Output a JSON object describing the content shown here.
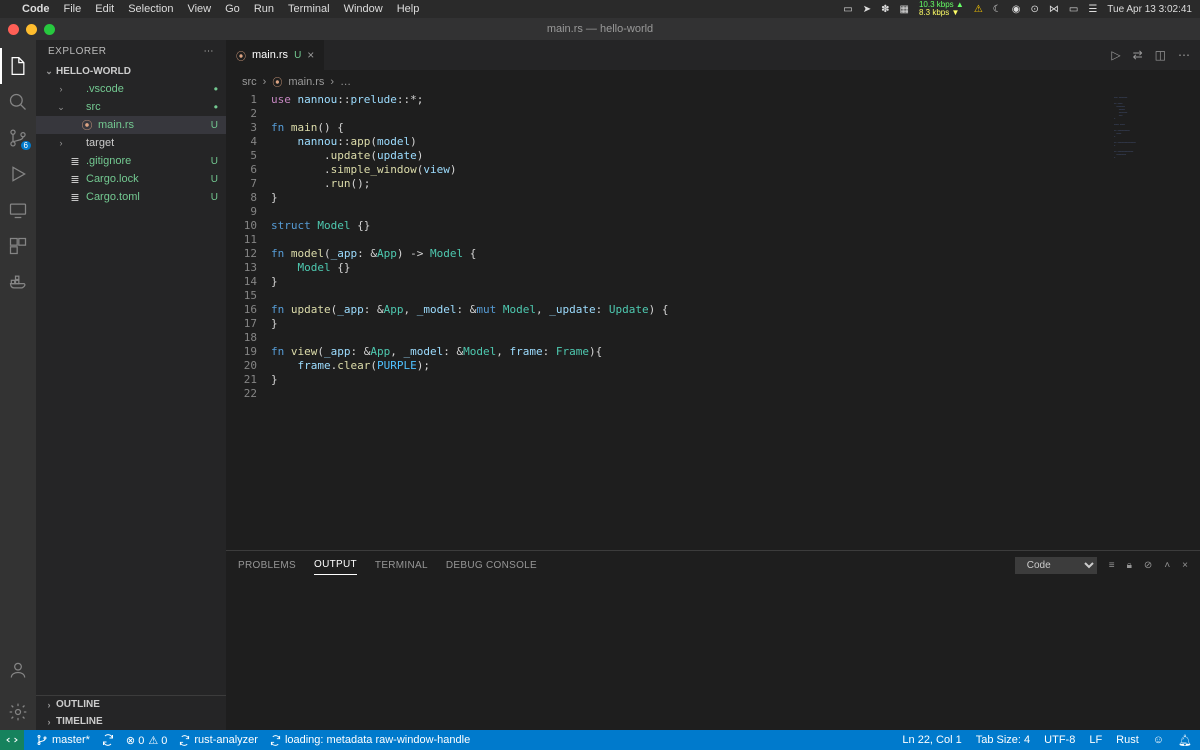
{
  "menubar": {
    "app": "Code",
    "items": [
      "File",
      "Edit",
      "Selection",
      "View",
      "Go",
      "Run",
      "Terminal",
      "Window",
      "Help"
    ],
    "datetime": "Tue Apr 13  3:02:41",
    "net_up": "10.3 kbps",
    "net_down": "8.3 kbps"
  },
  "window": {
    "title": "main.rs — hello-world"
  },
  "sidebar": {
    "title": "EXPLORER",
    "folder": "HELLO-WORLD",
    "items": [
      {
        "label": ".vscode",
        "kind": "folder-closed",
        "indent": 1,
        "status": "dot"
      },
      {
        "label": "src",
        "kind": "folder-open",
        "indent": 1,
        "status": "dot"
      },
      {
        "label": "main.rs",
        "kind": "rust",
        "indent": 2,
        "status": "U",
        "selected": true
      },
      {
        "label": "target",
        "kind": "folder-closed",
        "indent": 1,
        "status": ""
      },
      {
        "label": ".gitignore",
        "kind": "file",
        "indent": 1,
        "status": "U"
      },
      {
        "label": "Cargo.lock",
        "kind": "file",
        "indent": 1,
        "status": "U"
      },
      {
        "label": "Cargo.toml",
        "kind": "file",
        "indent": 1,
        "status": "U"
      }
    ],
    "outline": "OUTLINE",
    "timeline": "TIMELINE"
  },
  "scm_badge": "6",
  "tab": {
    "filename": "main.rs",
    "status": "U"
  },
  "breadcrumb": {
    "folder": "src",
    "file": "main.rs",
    "more": "…"
  },
  "code_lines": [
    [
      {
        "t": "use ",
        "c": "kw2"
      },
      {
        "t": "nannou",
        "c": "var"
      },
      {
        "t": "::",
        "c": ""
      },
      {
        "t": "prelude",
        "c": "var"
      },
      {
        "t": "::",
        "c": ""
      },
      {
        "t": "*",
        "c": ""
      },
      {
        "t": ";",
        "c": ""
      }
    ],
    [],
    [
      {
        "t": "fn ",
        "c": "kw"
      },
      {
        "t": "main",
        "c": "fn"
      },
      {
        "t": "() {",
        "c": ""
      }
    ],
    [
      {
        "t": "    ",
        "c": ""
      },
      {
        "t": "nannou",
        "c": "var"
      },
      {
        "t": "::",
        "c": ""
      },
      {
        "t": "app",
        "c": "fn"
      },
      {
        "t": "(",
        "c": ""
      },
      {
        "t": "model",
        "c": "var"
      },
      {
        "t": ")",
        "c": ""
      }
    ],
    [
      {
        "t": "        .",
        "c": ""
      },
      {
        "t": "update",
        "c": "fn"
      },
      {
        "t": "(",
        "c": ""
      },
      {
        "t": "update",
        "c": "var"
      },
      {
        "t": ")",
        "c": ""
      }
    ],
    [
      {
        "t": "        .",
        "c": ""
      },
      {
        "t": "simple_window",
        "c": "fn"
      },
      {
        "t": "(",
        "c": ""
      },
      {
        "t": "view",
        "c": "var"
      },
      {
        "t": ")",
        "c": ""
      }
    ],
    [
      {
        "t": "        .",
        "c": ""
      },
      {
        "t": "run",
        "c": "fn"
      },
      {
        "t": "();",
        "c": ""
      }
    ],
    [
      {
        "t": "}",
        "c": ""
      }
    ],
    [],
    [
      {
        "t": "struct ",
        "c": "kw"
      },
      {
        "t": "Model",
        "c": "type"
      },
      {
        "t": " {}",
        "c": ""
      }
    ],
    [],
    [
      {
        "t": "fn ",
        "c": "kw"
      },
      {
        "t": "model",
        "c": "fn"
      },
      {
        "t": "(",
        "c": ""
      },
      {
        "t": "_app",
        "c": "var"
      },
      {
        "t": ": &",
        "c": ""
      },
      {
        "t": "App",
        "c": "type"
      },
      {
        "t": ") -> ",
        "c": ""
      },
      {
        "t": "Model",
        "c": "type"
      },
      {
        "t": " {",
        "c": ""
      }
    ],
    [
      {
        "t": "    ",
        "c": ""
      },
      {
        "t": "Model",
        "c": "type"
      },
      {
        "t": " {}",
        "c": ""
      }
    ],
    [
      {
        "t": "}",
        "c": ""
      }
    ],
    [],
    [
      {
        "t": "fn ",
        "c": "kw"
      },
      {
        "t": "update",
        "c": "fn"
      },
      {
        "t": "(",
        "c": ""
      },
      {
        "t": "_app",
        "c": "var"
      },
      {
        "t": ": &",
        "c": ""
      },
      {
        "t": "App",
        "c": "type"
      },
      {
        "t": ", ",
        "c": ""
      },
      {
        "t": "_model",
        "c": "var"
      },
      {
        "t": ": &",
        "c": ""
      },
      {
        "t": "mut ",
        "c": "kw"
      },
      {
        "t": "Model",
        "c": "type"
      },
      {
        "t": ", ",
        "c": ""
      },
      {
        "t": "_update",
        "c": "var"
      },
      {
        "t": ": ",
        "c": ""
      },
      {
        "t": "Update",
        "c": "type"
      },
      {
        "t": ") {",
        "c": ""
      }
    ],
    [
      {
        "t": "}",
        "c": ""
      }
    ],
    [],
    [
      {
        "t": "fn ",
        "c": "kw"
      },
      {
        "t": "view",
        "c": "fn"
      },
      {
        "t": "(",
        "c": ""
      },
      {
        "t": "_app",
        "c": "var"
      },
      {
        "t": ": &",
        "c": ""
      },
      {
        "t": "App",
        "c": "type"
      },
      {
        "t": ", ",
        "c": ""
      },
      {
        "t": "_model",
        "c": "var"
      },
      {
        "t": ": &",
        "c": ""
      },
      {
        "t": "Model",
        "c": "type"
      },
      {
        "t": ", ",
        "c": ""
      },
      {
        "t": "frame",
        "c": "var"
      },
      {
        "t": ": ",
        "c": ""
      },
      {
        "t": "Frame",
        "c": "type"
      },
      {
        "t": "){",
        "c": ""
      }
    ],
    [
      {
        "t": "    ",
        "c": ""
      },
      {
        "t": "frame",
        "c": "var"
      },
      {
        "t": ".",
        "c": ""
      },
      {
        "t": "clear",
        "c": "fn"
      },
      {
        "t": "(",
        "c": ""
      },
      {
        "t": "PURPLE",
        "c": "const"
      },
      {
        "t": ");",
        "c": ""
      }
    ],
    [
      {
        "t": "}",
        "c": ""
      }
    ],
    []
  ],
  "panel": {
    "tabs": [
      "PROBLEMS",
      "OUTPUT",
      "TERMINAL",
      "DEBUG CONSOLE"
    ],
    "active": 1,
    "select": "Code"
  },
  "status": {
    "branch": "master*",
    "sync": "",
    "errors": "0",
    "warnings": "0",
    "analyzer": "rust-analyzer",
    "loading": "loading: metadata raw-window-handle",
    "ln_col": "Ln 22, Col 1",
    "tab_size": "Tab Size: 4",
    "encoding": "UTF-8",
    "eol": "LF",
    "lang": "Rust"
  }
}
